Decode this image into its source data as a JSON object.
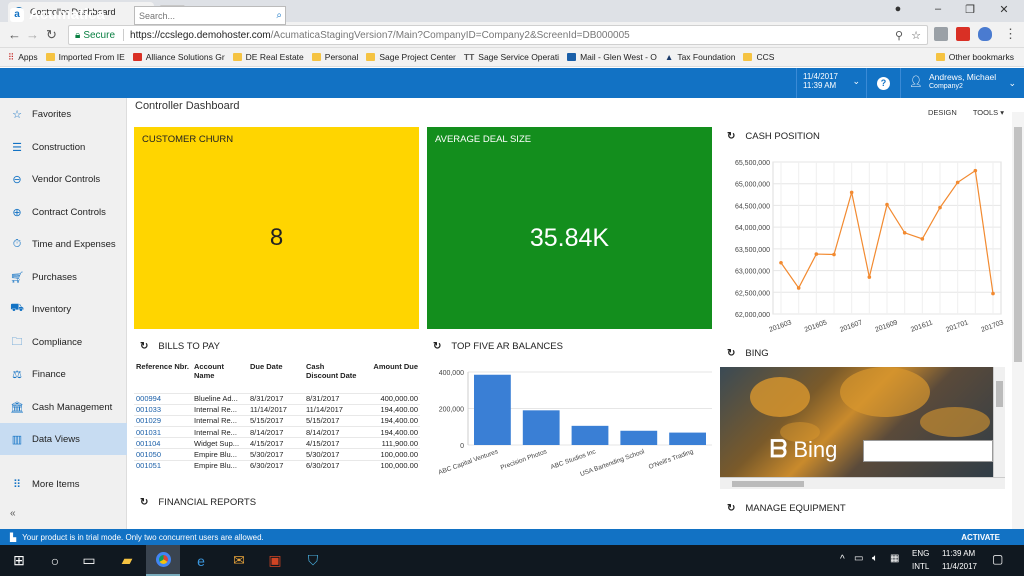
{
  "browser": {
    "tab_title": "Controller Dashboard",
    "secure_label": "Secure",
    "url_host": "https://ccslego.demohoster.com",
    "url_path": "/AcumaticaStagingVersion7/Main?CompanyID=Company2&ScreenId=DB000005",
    "bookmarks": [
      "Apps",
      "Imported From IE",
      "Alliance Solutions Gr",
      "DE Real Estate",
      "Personal",
      "Sage Project Center",
      "Sage Service Operati",
      "Mail - Glen West - O",
      "Tax Foundation",
      "CCS"
    ],
    "other_bookmarks": "Other bookmarks"
  },
  "app": {
    "logo": "Acumatica",
    "search_placeholder": "Search...",
    "date": "11/4/2017",
    "time": "11:39 AM",
    "user_name": "Andrews, Michael",
    "company": "Company2",
    "page_title": "Controller Dashboard",
    "design_label": "DESIGN",
    "tools_label": "TOOLS ▾"
  },
  "sidebar": {
    "items": [
      {
        "label": "Favorites",
        "icon": "star-icon"
      },
      {
        "label": "Construction",
        "icon": "list-icon"
      },
      {
        "label": "Vendor Controls",
        "icon": "minus-circle-icon"
      },
      {
        "label": "Contract Controls",
        "icon": "plus-circle-icon"
      },
      {
        "label": "Time and Expenses",
        "icon": "stopwatch-icon"
      },
      {
        "label": "Purchases",
        "icon": "cart-icon"
      },
      {
        "label": "Inventory",
        "icon": "truck-icon"
      },
      {
        "label": "Compliance",
        "icon": "folder-icon"
      },
      {
        "label": "Finance",
        "icon": "scales-icon"
      },
      {
        "label": "Cash Management",
        "icon": "bank-icon"
      },
      {
        "label": "Data Views",
        "icon": "bar-chart-icon"
      },
      {
        "label": "More Items",
        "icon": "grid-icon"
      }
    ]
  },
  "widgets": {
    "churn": {
      "title": "CUSTOMER CHURN",
      "value": "8",
      "color": "#ffd500"
    },
    "deal": {
      "title": "AVERAGE DEAL SIZE",
      "value": "35.84K",
      "color": "#138e1d"
    },
    "cash": {
      "title": "CASH POSITION"
    },
    "bills": {
      "title": "BILLS TO PAY",
      "headers": [
        "Reference Nbr.",
        "Account Name",
        "Due Date",
        "Cash Discount Date",
        "Amount Due"
      ],
      "rows": [
        [
          "000994",
          "Blueline Ad...",
          "8/31/2017",
          "8/31/2017",
          "400,000.00"
        ],
        [
          "001033",
          "Internal Re...",
          "11/14/2017",
          "11/14/2017",
          "194,400.00"
        ],
        [
          "001029",
          "Internal Re...",
          "5/15/2017",
          "5/15/2017",
          "194,400.00"
        ],
        [
          "001031",
          "Internal Re...",
          "8/14/2017",
          "8/14/2017",
          "194,400.00"
        ],
        [
          "001104",
          "Widget Sup...",
          "4/15/2017",
          "4/15/2017",
          "111,900.00"
        ],
        [
          "001050",
          "Empire Blu...",
          "5/30/2017",
          "5/30/2017",
          "100,000.00"
        ],
        [
          "001051",
          "Empire Blu...",
          "6/30/2017",
          "6/30/2017",
          "100,000.00"
        ]
      ]
    },
    "ar": {
      "title": "TOP FIVE AR BALANCES"
    },
    "bing": {
      "title": "BING",
      "logo_text": "Bing"
    },
    "financial": {
      "title": "FINANCIAL REPORTS"
    },
    "equipment": {
      "title": "MANAGE EQUIPMENT"
    }
  },
  "chart_data": [
    {
      "type": "line",
      "title": "CASH POSITION",
      "x": [
        "201603",
        "201604",
        "201605",
        "201606",
        "201607",
        "201608",
        "201609",
        "201610",
        "201611",
        "201612",
        "201701",
        "201702",
        "201703"
      ],
      "x_tick_labels": [
        "201603",
        "201605",
        "201607",
        "201609",
        "201611",
        "201701",
        "201703"
      ],
      "values": [
        63180000,
        62600000,
        63380000,
        63370000,
        64800000,
        62850000,
        64520000,
        63870000,
        63730000,
        64450000,
        65030000,
        65300000,
        62470000
      ],
      "ylim": [
        62000000,
        65500000
      ],
      "y_ticks": [
        "62,000,000",
        "62,500,000",
        "63,000,000",
        "63,500,000",
        "64,000,000",
        "64,500,000",
        "65,000,000",
        "65,500,000"
      ],
      "y_tick_values": [
        62000000,
        62500000,
        63000000,
        63500000,
        64000000,
        64500000,
        65000000,
        65500000
      ],
      "color": "#f28a30",
      "grid": true
    },
    {
      "type": "bar",
      "title": "TOP FIVE AR BALANCES",
      "categories": [
        "ABC Capital Ventures",
        "Precision Photos",
        "ABC Studios Inc",
        "USA Bartending School",
        "O'Neill's Trading"
      ],
      "values": [
        385000,
        190000,
        105000,
        78000,
        68000
      ],
      "ylim": [
        0,
        400000
      ],
      "y_ticks": [
        "0",
        "200,000",
        "400,000"
      ],
      "y_tick_values": [
        0,
        200000,
        400000
      ],
      "color": "#3a7fd5",
      "grid": true
    }
  ],
  "trial": {
    "message": "Your product is in trial mode. Only two concurrent users are allowed.",
    "action": "ACTIVATE"
  },
  "taskbar": {
    "lang1": "ENG",
    "lang2": "INTL",
    "time": "11:39 AM",
    "date": "11/4/2017"
  }
}
